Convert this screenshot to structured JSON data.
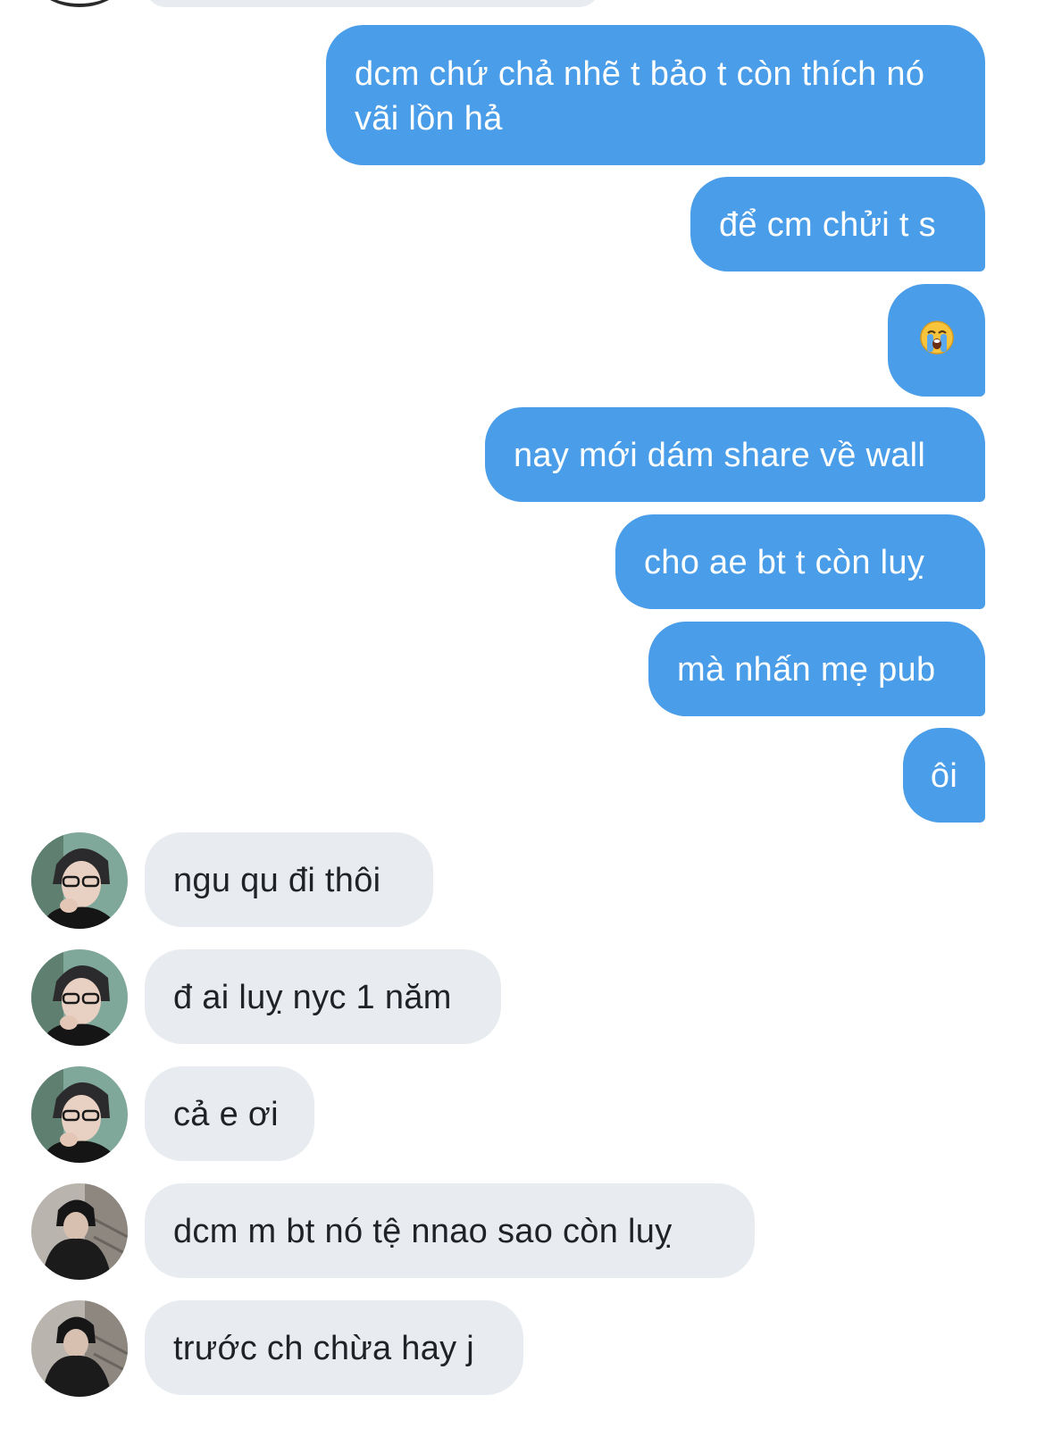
{
  "messages": {
    "outgoing": [
      {
        "text": "dcm chứ chả nhẽ t bảo t còn thích nó vãi lồn hả"
      },
      {
        "text": "để cm chửi t s"
      },
      {
        "emoji": "😭"
      },
      {
        "text": "nay mới dám share về wall"
      },
      {
        "text": "cho ae bt t còn luỵ"
      },
      {
        "text": "mà nhấn mẹ pub"
      },
      {
        "text": "ôi"
      }
    ],
    "incoming": [
      {
        "text": "ngu qu đi thôi"
      },
      {
        "text": "đ ai luỵ nyc 1 năm"
      },
      {
        "text": "cả e ơi"
      },
      {
        "text": "dcm m bt nó tệ nnao sao còn luỵ"
      },
      {
        "text": "trước ch chừa hay j"
      }
    ]
  },
  "colors": {
    "outgoing_bubble": "#4a9de8",
    "incoming_bubble": "#e8ecf0",
    "outgoing_text": "#ffffff",
    "incoming_text": "#1f2328"
  }
}
